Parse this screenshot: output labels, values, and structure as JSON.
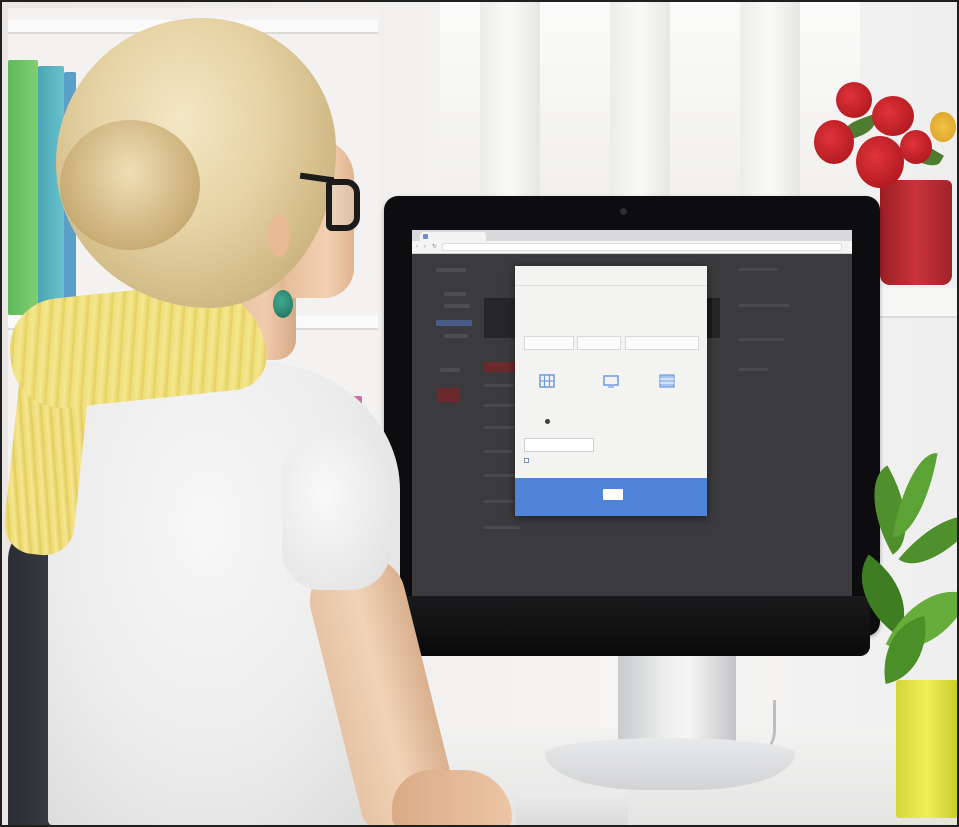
{
  "scene": {
    "description_label": "",
    "monitor_screen": {
      "browser": {
        "tab_title": "",
        "url": ""
      },
      "modal": {
        "title": "",
        "description_line_1": "",
        "description_line_2": "",
        "section_1_label": "",
        "field_1_placeholder": "",
        "field_2_placeholder": "",
        "field_3_placeholder": "",
        "section_2_label": "",
        "options": [
          {
            "label": "",
            "sub": "",
            "icon": "grid-icon"
          },
          {
            "label": "",
            "sub": "",
            "icon": "monitor-icon"
          },
          {
            "label": "",
            "sub": "",
            "icon": "table-icon"
          }
        ],
        "input_label": "",
        "input_value": "",
        "checkbox_label": "",
        "cancel_label": "",
        "ok_label": "",
        "colors": {
          "footer": "#4f84d8",
          "modal_bg": "#f3f3f2",
          "icon": "#6f9be0"
        }
      }
    }
  }
}
